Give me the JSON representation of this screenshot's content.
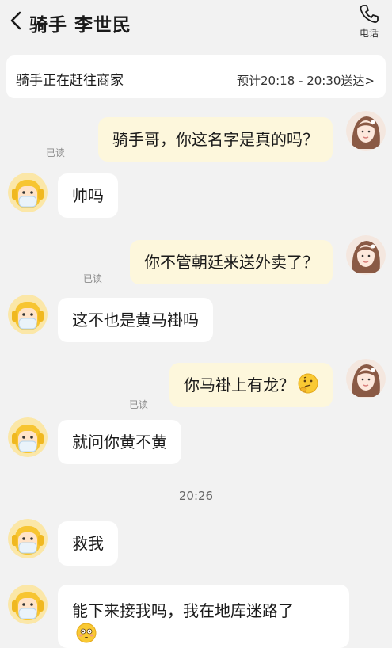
{
  "header": {
    "title": "骑手 李世民",
    "call_label": "电话"
  },
  "status": {
    "text": "骑手正在赶往商家",
    "eta": "预计20:18 - 20:30送达>"
  },
  "messages": [
    {
      "from": "me",
      "text": "骑手哥，你这名字是真的吗？",
      "read": "已读"
    },
    {
      "from": "rider",
      "text": "帅吗"
    },
    {
      "from": "me",
      "text": "你不管朝廷来送外卖了？",
      "read": "已读"
    },
    {
      "from": "rider",
      "text": "这不也是黄马褂吗"
    },
    {
      "from": "me",
      "text": "你马褂上有龙？",
      "read": "已读",
      "emoji": "thinking-face-emoji"
    },
    {
      "from": "rider",
      "text": "就问你黄不黄"
    },
    {
      "from": "rider",
      "text": "救我"
    },
    {
      "from": "rider",
      "text": "能下来接我吗，我在地库迷路了",
      "emoji": "flushed-face-emoji"
    }
  ],
  "timestamp": "20:26",
  "colors": {
    "background": "#f2f2f2",
    "my_bubble": "#fdf7dc",
    "rider_bubble": "#ffffff",
    "rider_avatar": "#f7c531"
  }
}
